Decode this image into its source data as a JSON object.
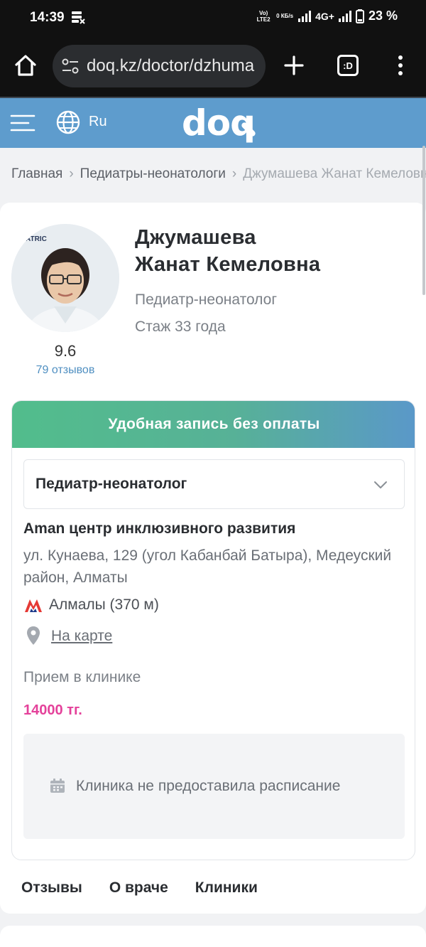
{
  "statusbar": {
    "time": "14:39",
    "volte": "Vo) LTE2",
    "speed": "0 КБ/s",
    "network": "4G+",
    "battery": "23 %"
  },
  "browser": {
    "url": "doq.kz/doctor/dzhuma"
  },
  "site": {
    "lang": "Ru",
    "logo": "doq"
  },
  "breadcrumb": {
    "home": "Главная",
    "category": "Педиатры-неонатологи",
    "current": "Джумашева Жанат Кемеловна"
  },
  "doctor": {
    "name_first": "Джумашева",
    "name_rest": "Жанат Кемеловна",
    "specialty": "Педиатр-неонатолог",
    "experience": "Стаж 33 года",
    "rating": "9.6",
    "reviews": "79 отзывов",
    "photo_text": "DIATRIC"
  },
  "booking": {
    "banner": "Удобная запись без оплаты",
    "selected_specialty": "Педиатр-неонатолог",
    "clinic_name": "Aman центр инклюзивного развития",
    "clinic_address": "ул. Кунаева, 129 (угол Кабанбай Батыра), Медеуский район, Алматы",
    "metro": "Алмалы (370 м)",
    "map_link": "На карте",
    "appointment_type": "Прием в клинике",
    "price": "14000 тг.",
    "schedule_note": "Клиника не предоставила расписание"
  },
  "tabs": [
    "Отзывы",
    "О враче",
    "Клиники"
  ],
  "colors": {
    "header": "#5e9ccd",
    "price": "#e4419a",
    "link": "#4f8fc1",
    "banner_start": "#52bd8c",
    "banner_end": "#5a98c9"
  }
}
